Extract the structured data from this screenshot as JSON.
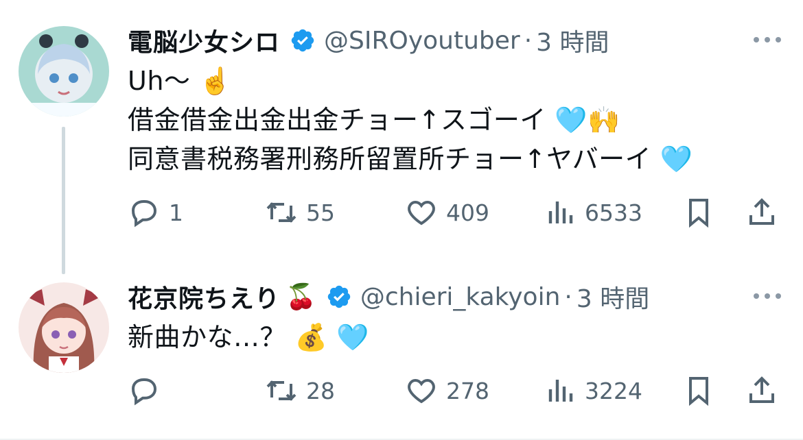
{
  "tweets": [
    {
      "author_name": "電脳少女シロ",
      "name_emoji": "",
      "handle": "@SIROyoutuber",
      "separator": "·",
      "time": "3 時間",
      "lines": [
        "Uh〜 ☝️",
        "借金借金出金出金チョー↑スゴーイ 🩵🙌",
        "同意書税務署刑務所留置所チョー↑ヤバーイ 🩵"
      ],
      "replies": "1",
      "retweets": "55",
      "likes": "409",
      "views": "6533",
      "avatar_colors": [
        "#a9d9d2",
        "#e7eef3"
      ]
    },
    {
      "author_name": "花京院ちえり",
      "name_emoji": "🍒",
      "handle": "@chieri_kakyoin",
      "separator": "·",
      "time": "3 時間",
      "lines": [
        "新曲かな…？ 💰 🩵"
      ],
      "replies": "",
      "retweets": "28",
      "likes": "278",
      "views": "3224",
      "avatar_colors": [
        "#f7e8e6",
        "#a05a4e"
      ]
    }
  ],
  "icons": {
    "verified": "verified-badge-icon",
    "reply": "reply-icon",
    "retweet": "retweet-icon",
    "like": "heart-icon",
    "views": "views-bar-chart-icon",
    "bookmark": "bookmark-icon",
    "share": "share-icon",
    "more": "more-dots-icon"
  },
  "colors": {
    "text": "#0f1419",
    "secondary": "#536471",
    "verified": "#1d9bf0",
    "thread_line": "#cfd9de"
  }
}
